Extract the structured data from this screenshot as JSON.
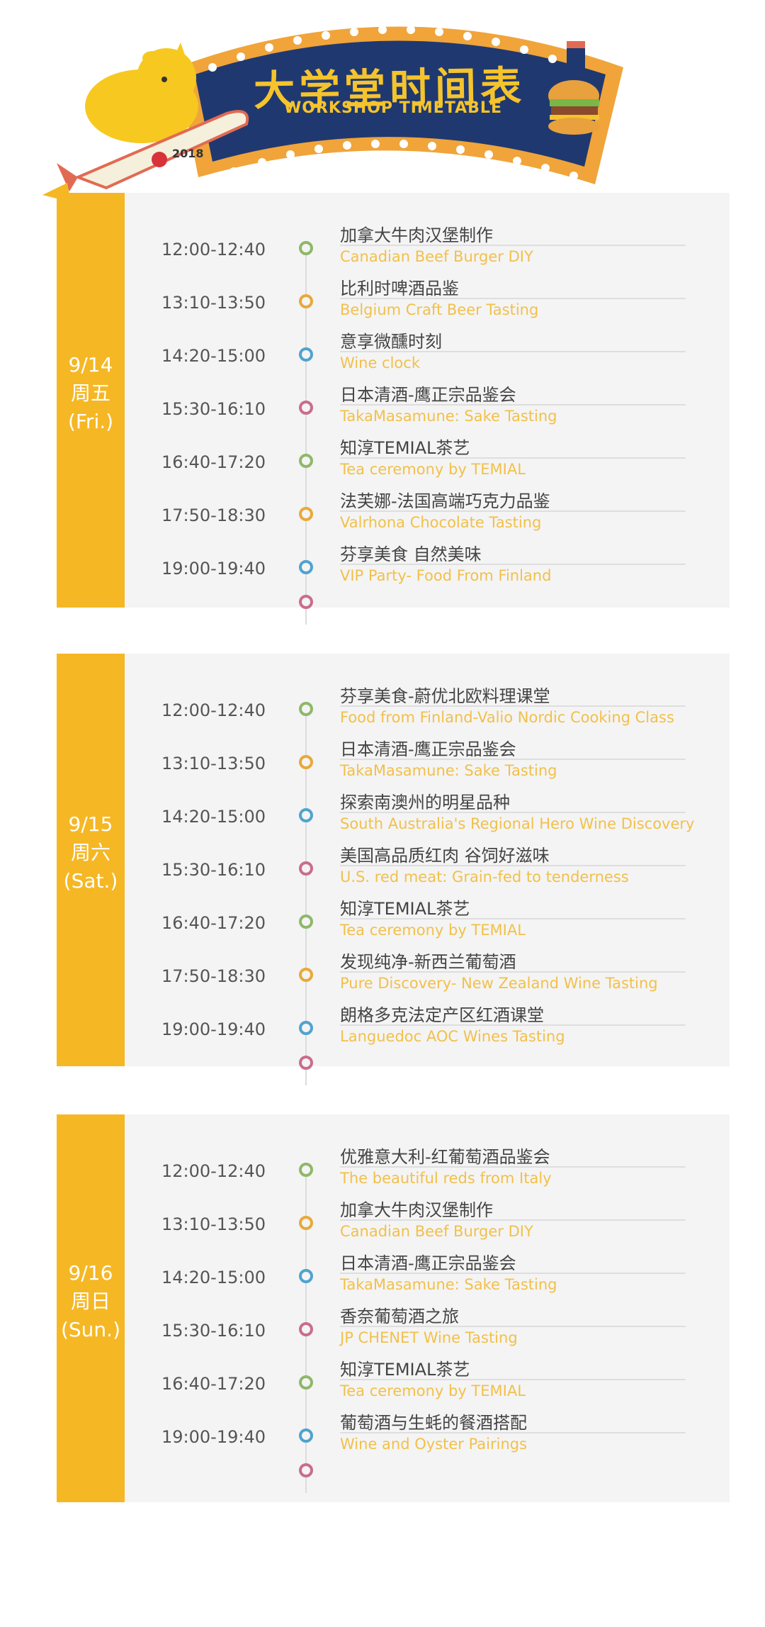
{
  "header": {
    "title": "大学堂时间表",
    "subtitle": "WORKSHOP TIMETABLE",
    "year": "2018",
    "colors": {
      "navy": "#1f3970",
      "frame": "#f0a43a",
      "text": "#f5c32c"
    }
  },
  "colors": {
    "bar": "#f5b724",
    "panel": "#f4f4f4",
    "dot_green": "#8fb86a",
    "dot_orange": "#e8a93a",
    "dot_blue": "#4fa3cf",
    "dot_pink": "#c96d8e",
    "en_text": "#f2c04a"
  },
  "days": [
    {
      "date": "9/14",
      "weekday": "周五",
      "weekday_en": "(Fri.)",
      "slots": [
        {
          "time": "12:00-12:40",
          "zh": "加拿大牛肉汉堡制作",
          "en": "Canadian Beef Burger DIY",
          "dot": "green"
        },
        {
          "time": "13:10-13:50",
          "zh": "比利时啤酒品鉴",
          "en": "Belgium Craft Beer Tasting",
          "dot": "orange"
        },
        {
          "time": "14:20-15:00",
          "zh": "意享微醺时刻",
          "en": "Wine  clock",
          "dot": "blue"
        },
        {
          "time": "15:30-16:10",
          "zh": "日本清酒-鹰正宗品鉴会",
          "en": "TakaMasamune: Sake Tasting",
          "dot": "pink"
        },
        {
          "time": "16:40-17:20",
          "zh": "知淳TEMIAL茶艺",
          "en": "Tea ceremony by TEMIAL",
          "dot": "green"
        },
        {
          "time": "17:50-18:30",
          "zh": "法芙娜-法国高端巧克力品鉴",
          "en": "Valrhona Chocolate Tasting",
          "dot": "orange"
        },
        {
          "time": "19:00-19:40",
          "zh": "芬享美食 自然美味",
          "en": "VIP Party- Food From Finland",
          "dot": "blue"
        }
      ]
    },
    {
      "date": "9/15",
      "weekday": "周六",
      "weekday_en": "(Sat.)",
      "slots": [
        {
          "time": "12:00-12:40",
          "zh": "芬享美食-蔚优北欧料理课堂",
          "en": "Food from Finland-Valio Nordic Cooking Class",
          "dot": "green"
        },
        {
          "time": "13:10-13:50",
          "zh": "日本清酒-鹰正宗品鉴会",
          "en": "TakaMasamune: Sake Tasting",
          "dot": "orange"
        },
        {
          "time": "14:20-15:00",
          "zh": "探索南澳州的明星品种",
          "en": "South Australia's Regional Hero Wine Discovery",
          "dot": "blue"
        },
        {
          "time": "15:30-16:10",
          "zh": "美国高品质红肉 谷饲好滋味",
          "en": "U.S. red meat: Grain-fed to tenderness",
          "dot": "pink"
        },
        {
          "time": "16:40-17:20",
          "zh": "知淳TEMIAL茶艺",
          "en": "Tea ceremony by TEMIAL",
          "dot": "green"
        },
        {
          "time": "17:50-18:30",
          "zh": "发现纯净-新西兰葡萄酒",
          "en": "Pure Discovery- New Zealand Wine Tasting",
          "dot": "orange"
        },
        {
          "time": "19:00-19:40",
          "zh": "朗格多克法定产区红酒课堂",
          "en": "Languedoc AOC Wines Tasting",
          "dot": "blue"
        }
      ]
    },
    {
      "date": "9/16",
      "weekday": "周日",
      "weekday_en": "(Sun.)",
      "slots": [
        {
          "time": "12:00-12:40",
          "zh": "优雅意大利-红葡萄酒品鉴会",
          "en": "The beautiful reds from Italy",
          "dot": "green"
        },
        {
          "time": "13:10-13:50",
          "zh": "加拿大牛肉汉堡制作",
          "en": "Canadian Beef Burger DIY",
          "dot": "orange"
        },
        {
          "time": "14:20-15:00",
          "zh": "日本清酒-鹰正宗品鉴会",
          "en": "TakaMasamune: Sake Tasting",
          "dot": "blue"
        },
        {
          "time": "15:30-16:10",
          "zh": "香奈葡萄酒之旅",
          "en": "JP CHENET Wine Tasting",
          "dot": "pink"
        },
        {
          "time": "16:40-17:20",
          "zh": "知淳TEMIAL茶艺",
          "en": "Tea ceremony by TEMIAL",
          "dot": "green"
        },
        {
          "time": "19:00-19:40",
          "zh": "葡萄酒与生蚝的餐酒搭配",
          "en": "Wine and Oyster Pairings",
          "dot": "blue"
        }
      ]
    }
  ]
}
